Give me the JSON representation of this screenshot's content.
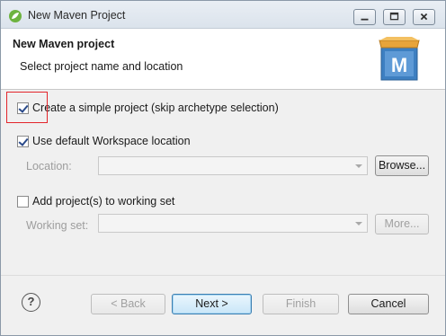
{
  "window": {
    "title": "New Maven Project",
    "controls": {
      "minimize": "minimize",
      "maximize": "maximize",
      "close": "close"
    }
  },
  "header": {
    "title": "New Maven project",
    "subtitle": "Select project name and location",
    "logo_letter": "M"
  },
  "options": {
    "simple_project": {
      "label": "Create a simple project (skip archetype selection)",
      "checked": true
    },
    "default_workspace": {
      "label": "Use default Workspace location",
      "checked": true
    },
    "location": {
      "label": "Location:",
      "value": "",
      "enabled": false
    },
    "browse_label": "Browse...",
    "working_set": {
      "label": "Add project(s) to working set",
      "checked": false
    },
    "working_set_field": {
      "label": "Working set:",
      "value": "",
      "enabled": false
    },
    "more_label": "More..."
  },
  "buttons": {
    "help": "?",
    "back": "< Back",
    "next": "Next >",
    "finish": "Finish",
    "cancel": "Cancel"
  },
  "colors": {
    "highlight": "#e3252b",
    "accent": "#3c7fb1"
  }
}
